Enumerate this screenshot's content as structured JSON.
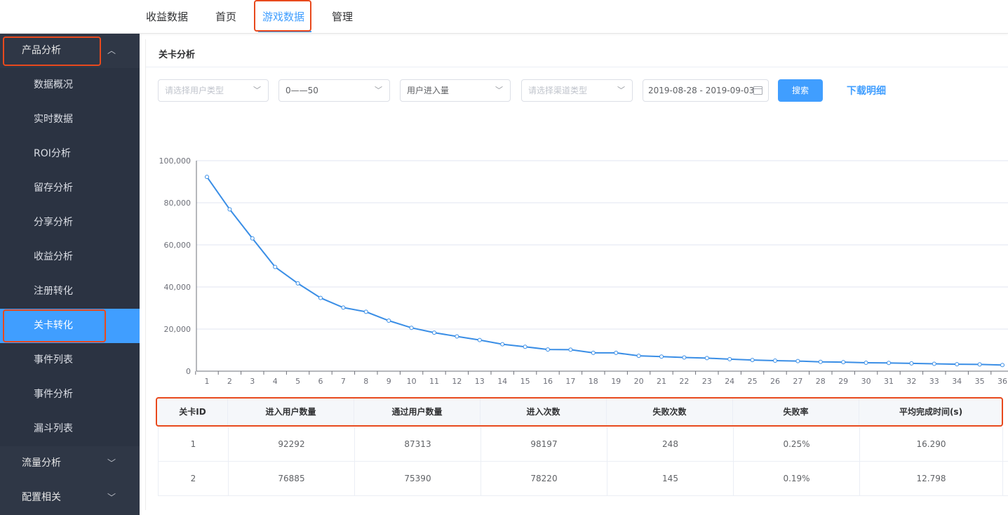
{
  "topnav": {
    "items": [
      {
        "label": "收益数据"
      },
      {
        "label": "首页"
      },
      {
        "label": "游戏数据"
      },
      {
        "label": "管理"
      }
    ],
    "active_index": 2
  },
  "sidebar": {
    "group_product": {
      "label": "产品分析",
      "expanded": true
    },
    "items": [
      {
        "label": "数据概况"
      },
      {
        "label": "实时数据"
      },
      {
        "label": "ROI分析"
      },
      {
        "label": "留存分析"
      },
      {
        "label": "分享分析"
      },
      {
        "label": "收益分析"
      },
      {
        "label": "注册转化"
      },
      {
        "label": "关卡转化"
      },
      {
        "label": "事件列表"
      },
      {
        "label": "事件分析"
      },
      {
        "label": "漏斗列表"
      }
    ],
    "active_index": 7,
    "group_traffic": {
      "label": "流量分析"
    },
    "group_config": {
      "label": "配置相关"
    }
  },
  "page": {
    "title": "关卡分析"
  },
  "filters": {
    "user_type": {
      "placeholder": "请选择用户类型",
      "value": ""
    },
    "level_range": {
      "value": "0——50"
    },
    "metric": {
      "value": "用户进入量"
    },
    "channel": {
      "placeholder": "请选择渠道类型",
      "value": ""
    },
    "date_range": {
      "value": "2019-08-28 - 2019-09-03"
    },
    "search_label": "搜索",
    "download_label": "下载明细"
  },
  "colors": {
    "accent": "#409eff",
    "sidebar_bg": "#2b3342",
    "highlight_box": "#e8491d"
  },
  "chart_data": {
    "type": "line",
    "x": [
      1,
      2,
      3,
      4,
      5,
      6,
      7,
      8,
      9,
      10,
      11,
      12,
      13,
      14,
      15,
      16,
      17,
      18,
      19,
      20,
      21,
      22,
      23,
      24,
      25,
      26,
      27,
      28,
      29,
      30,
      31,
      32,
      33,
      34,
      35,
      36
    ],
    "y_ticks": [
      "100,000",
      "80,000",
      "60,000",
      "40,000",
      "20,000",
      "0"
    ],
    "series": [
      {
        "values": [
          92292,
          76885,
          63100,
          49500,
          41700,
          34800,
          30200,
          28200,
          24000,
          20600,
          18300,
          16500,
          14800,
          12800,
          11600,
          10300,
          10200,
          8700,
          8700,
          7300,
          6900,
          6500,
          6200,
          5700,
          5300,
          5000,
          4800,
          4400,
          4300,
          4000,
          3900,
          3700,
          3500,
          3300,
          3200,
          2900
        ]
      }
    ],
    "ylim": [
      0,
      100000
    ],
    "grid": true,
    "color": "#3a8ee6"
  },
  "table": {
    "headers": [
      "关卡ID",
      "进入用户数量",
      "通过用户数量",
      "进入次数",
      "失败次数",
      "失败率",
      "平均完成时间(s)"
    ],
    "rows": [
      [
        "1",
        "92292",
        "87313",
        "98197",
        "248",
        "0.25%",
        "16.290"
      ],
      [
        "2",
        "76885",
        "75390",
        "78220",
        "145",
        "0.19%",
        "12.798"
      ]
    ]
  }
}
